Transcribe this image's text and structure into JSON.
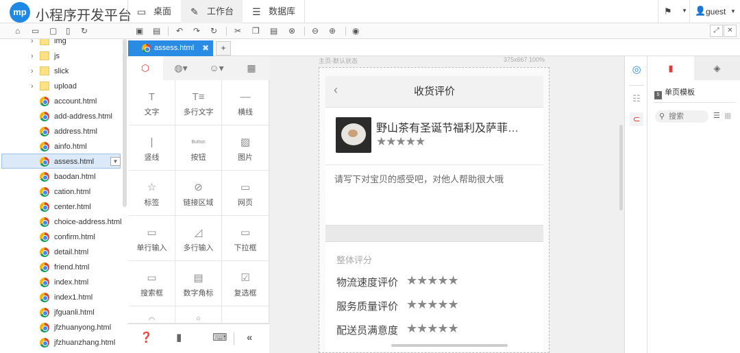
{
  "app": {
    "logo_text": "mp",
    "title": "小程序开发平台"
  },
  "nav": [
    {
      "label": "桌面",
      "icon": "desktop-icon"
    },
    {
      "label": "工作台",
      "icon": "edit-icon",
      "active": true
    },
    {
      "label": "数据库",
      "icon": "database-icon"
    }
  ],
  "user": {
    "name": "guest"
  },
  "toolbar_icons": [
    "save-icon",
    "save-all-icon",
    "undo-icon",
    "redo-icon",
    "refresh-icon",
    "cut-icon",
    "copy-icon",
    "paste-icon",
    "delete-icon",
    "zoom-out-icon",
    "zoom-in-icon",
    "preview-eye-icon"
  ],
  "file_tree": [
    {
      "name": "img",
      "type": "folder"
    },
    {
      "name": "js",
      "type": "folder"
    },
    {
      "name": "slick",
      "type": "folder"
    },
    {
      "name": "upload",
      "type": "folder"
    },
    {
      "name": "account.html",
      "type": "file"
    },
    {
      "name": "add-address.html",
      "type": "file"
    },
    {
      "name": "address.html",
      "type": "file"
    },
    {
      "name": "ainfo.html",
      "type": "file"
    },
    {
      "name": "assess.html",
      "type": "file",
      "selected": true
    },
    {
      "name": "baodan.html",
      "type": "file"
    },
    {
      "name": "cation.html",
      "type": "file"
    },
    {
      "name": "center.html",
      "type": "file"
    },
    {
      "name": "choice-address.html",
      "type": "file"
    },
    {
      "name": "confirm.html",
      "type": "file"
    },
    {
      "name": "detail.html",
      "type": "file"
    },
    {
      "name": "friend.html",
      "type": "file"
    },
    {
      "name": "index.html",
      "type": "file"
    },
    {
      "name": "index1.html",
      "type": "file"
    },
    {
      "name": "jfguanli.html",
      "type": "file"
    },
    {
      "name": "jfzhuanyong.html",
      "type": "file"
    },
    {
      "name": "jfzhuanzhang.html",
      "type": "file"
    }
  ],
  "editor_tab": {
    "label": "assess.html",
    "close": "✖",
    "add": "+"
  },
  "components": [
    {
      "label": "文字",
      "icon": "T"
    },
    {
      "label": "多行文字",
      "icon": "T≡"
    },
    {
      "label": "横线",
      "icon": "—"
    },
    {
      "label": "竖线",
      "icon": "|"
    },
    {
      "label": "按钮",
      "icon": "Button"
    },
    {
      "label": "图片",
      "icon": "▨"
    },
    {
      "label": "标签",
      "icon": "☆"
    },
    {
      "label": "链接区域",
      "icon": "⊘"
    },
    {
      "label": "网页",
      "icon": "▭"
    },
    {
      "label": "单行输入",
      "icon": "▭"
    },
    {
      "label": "多行输入",
      "icon": "◿"
    },
    {
      "label": "下拉框",
      "icon": "▭"
    },
    {
      "label": "搜索框",
      "icon": "▭"
    },
    {
      "label": "数字角标",
      "icon": "▤"
    },
    {
      "label": "复选框",
      "icon": "☑"
    }
  ],
  "canvas": {
    "state_label": "主页-默认状态",
    "size_label": "375x667 100%"
  },
  "phone": {
    "title": "收货评价",
    "back": "‹",
    "product_title": "野山茶有圣诞节福利及萨菲…",
    "stars": "★★★★★",
    "placeholder": "请写下对宝贝的感受吧，对他人帮助很大哦",
    "score_header": "整体评分",
    "scores": [
      {
        "label": "物流速度评价",
        "stars": "★★★★★"
      },
      {
        "label": "服务质量评价",
        "stars": "★★★★★"
      },
      {
        "label": "配送员满意度",
        "stars": "★★★★★"
      }
    ]
  },
  "right_panel": {
    "template_label": "单页模板",
    "search_placeholder": "搜索"
  },
  "colors": {
    "accent": "#2a8be4",
    "tab_active": "#e53935",
    "logo": "#1e88e5"
  }
}
